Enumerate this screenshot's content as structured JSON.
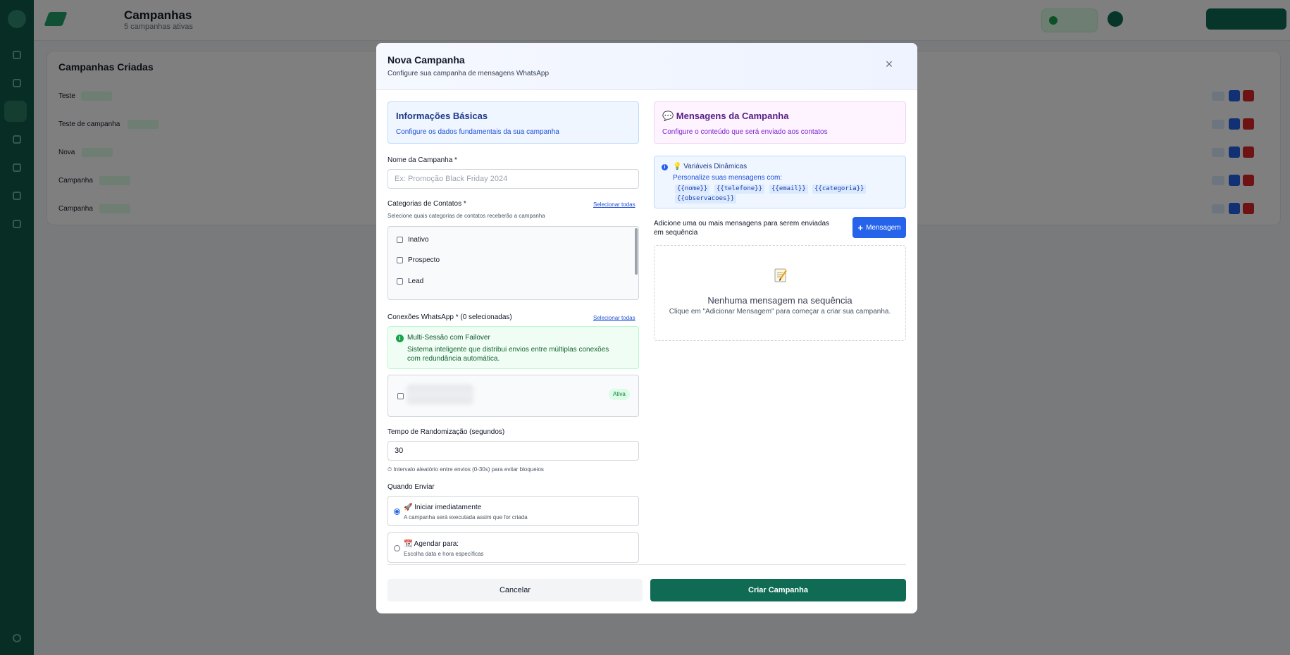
{
  "app": {
    "page_title": "Campanhas",
    "page_subtitle": "5 campanhas ativas",
    "list_title": "Campanhas Criadas",
    "rows": [
      {
        "name": "Teste"
      },
      {
        "name": "Teste de campanha"
      },
      {
        "name": "Nova"
      },
      {
        "name": "Campanha"
      },
      {
        "name": "Campanha"
      }
    ]
  },
  "modal": {
    "title": "Nova Campanha",
    "subtitle": "Configure sua campanha de mensagens WhatsApp",
    "close_icon": "×",
    "left": {
      "card_title": "Informações Básicas",
      "card_subtitle": "Configure os dados fundamentais da sua campanha",
      "name_label": "Nome da Campanha *",
      "name_placeholder": "Ex: Promoção Black Friday 2024",
      "categories_label": "Categorias de Contatos *",
      "categories_select_all": "Selecionar todas",
      "categories_hint": "Selecione quais categorias de contatos receberão a campanha",
      "categories": [
        "Inativo",
        "Prospecto",
        "Lead"
      ],
      "connections_label": "Conexões WhatsApp * (0 selecionadas)",
      "connections_select_all": "Selecionar todas",
      "failover_title": "Multi-Sessão com Failover",
      "failover_text": "Sistema inteligente que distribui envios entre múltiplas conexões com redundância automática.",
      "connection_status": "Ativa",
      "random_label": "Tempo de Randomização (segundos)",
      "random_value": "30",
      "random_hint": "⏱ Intervalo aleatório entre envios (0-30s) para evitar bloqueios",
      "when_label": "Quando Enviar",
      "options": [
        {
          "title": "🚀 Iniciar imediatamente",
          "subtitle": "A campanha será executada assim que for criada",
          "checked": true
        },
        {
          "title": "📆 Agendar para:",
          "subtitle": "Escolha data e hora específicas",
          "checked": false
        }
      ]
    },
    "right": {
      "card_title": "💬 Mensagens da Campanha",
      "card_subtitle": "Configure o conteúdo que será enviado aos contatos",
      "vars_title": "💡 Variáveis Dinâmicas",
      "vars_text": "Personalize suas mensagens com:",
      "vars": [
        "{{nome}}",
        "{{telefone}}",
        "{{email}}",
        "{{categoria}}",
        "{{observacoes}}"
      ],
      "sequence_text": "Adicione uma ou mais mensagens para serem enviadas em sequência",
      "add_message_label": "Mensagem",
      "empty_title": "Nenhuma mensagem na sequência",
      "empty_subtitle": "Clique em \"Adicionar Mensagem\" para começar a criar sua campanha."
    },
    "footer": {
      "cancel_label": "Cancelar",
      "create_label": "Criar Campanha"
    }
  }
}
